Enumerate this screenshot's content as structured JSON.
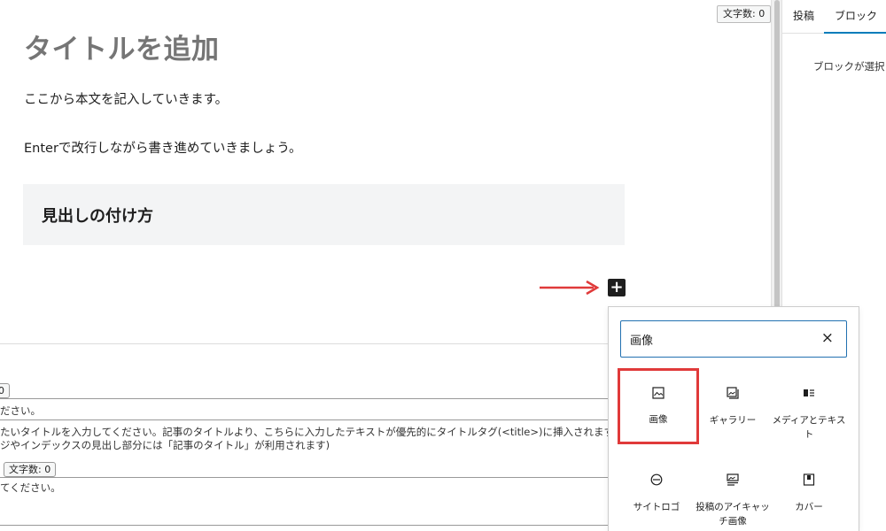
{
  "editor": {
    "word_count_label": "文字数: 0",
    "title": "タイトルを追加",
    "paragraph_1": "ここから本文を記入していきます。",
    "paragraph_2": "Enterで改行しながら書き進めていきましょう。",
    "heading": "見出しの付け方",
    "inserter_toggle_glyph": "+"
  },
  "meta": {
    "count_1": "0",
    "text_1": "ださい。",
    "text_2": "たいタイトルを入力してください。記事のタイトルより、こちらに入力したテキストが優先的にタイトルタグ(<title>)に挿入されます。一般的に日本",
    "text_3": "ジやインデックスの見出し部分には「記事のタイトル」が利用されます)",
    "count_2": "文字数: 0",
    "text_4": "てください。"
  },
  "sidebar": {
    "tabs": [
      {
        "label": "投稿",
        "active": false
      },
      {
        "label": "ブロック",
        "active": true
      }
    ],
    "message": "ブロックが選択さ"
  },
  "inserter": {
    "search_value": "画像",
    "clear_glyph": "×",
    "blocks": [
      {
        "label": "画像",
        "icon": "image-icon"
      },
      {
        "label": "ギャラリー",
        "icon": "gallery-icon"
      },
      {
        "label": "メディアとテキスト",
        "icon": "media-text-icon"
      },
      {
        "label": "サイトロゴ",
        "icon": "site-logo-icon"
      },
      {
        "label": "投稿のアイキャッチ画像",
        "icon": "featured-image-icon"
      },
      {
        "label": "カバー",
        "icon": "cover-icon"
      }
    ]
  },
  "colors": {
    "annotation_red": "#e03a3a",
    "accent_blue": "#2271b1"
  }
}
